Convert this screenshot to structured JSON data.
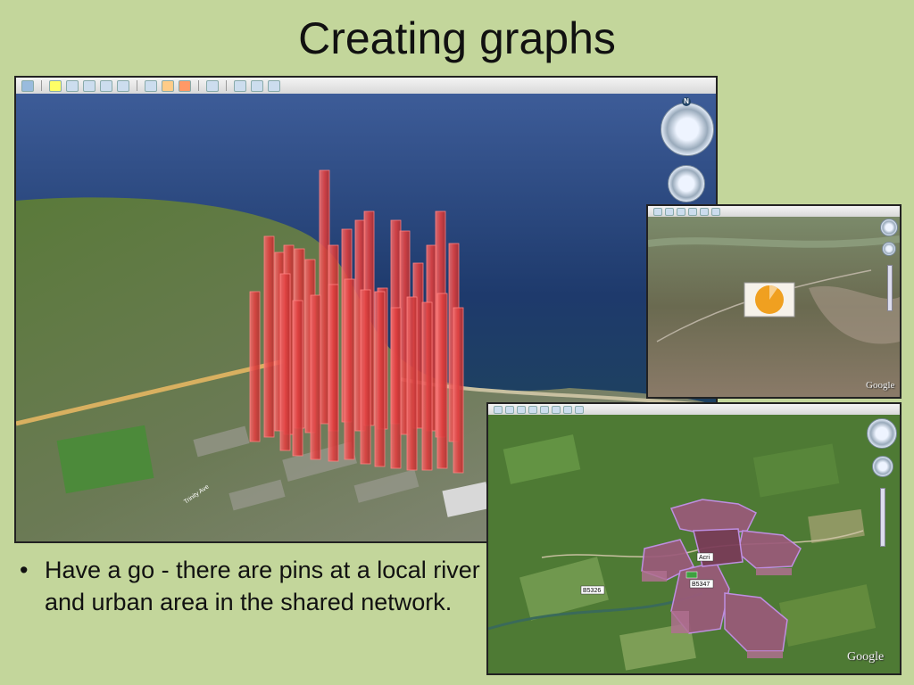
{
  "slide": {
    "title": "Creating graphs",
    "bullet_text": "Have a go - there are pins at a local river and urban area in the shared network."
  },
  "screenshots": [
    {
      "name": "coastal-town-bar-graph",
      "logo": ""
    },
    {
      "name": "hillside-pie-chart",
      "logo": "Google"
    },
    {
      "name": "village-extruded-polygons",
      "logo": "Google"
    }
  ],
  "map_labels": {
    "road_1": "Trinity Ave",
    "pin_1": "B5326",
    "pin_2": "Acri",
    "pin_3": "B5347"
  },
  "colors": {
    "slide_background": "#c3d69b",
    "bars": "#e85050",
    "polygons": "#9b5a7a",
    "pie": "#f0a020"
  }
}
